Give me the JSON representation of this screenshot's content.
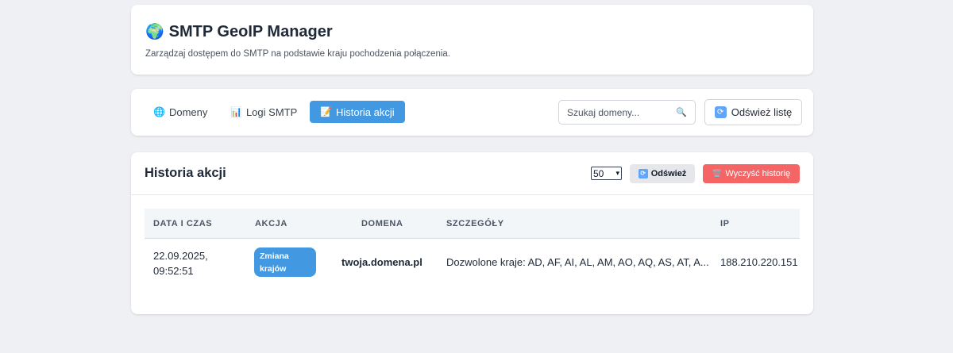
{
  "header": {
    "globe_icon": "🌍",
    "title": "SMTP GeoIP Manager",
    "subtitle": "Zarządzaj dostępem do SMTP na podstawie kraju pochodzenia połączenia."
  },
  "nav": {
    "tabs": [
      {
        "icon": "🌐",
        "icon_name": "globe-icon",
        "label": "Domeny",
        "active": false
      },
      {
        "icon": "📊",
        "icon_name": "bar-chart-icon",
        "label": "Logi SMTP",
        "active": false
      },
      {
        "icon": "📝",
        "icon_name": "memo-icon",
        "label": "Historia akcji",
        "active": true
      }
    ],
    "search": {
      "placeholder": "Szukaj domeny...",
      "value": "",
      "icon": "🔍"
    },
    "refresh_list": {
      "icon": "🔄",
      "label": "Odśwież listę"
    }
  },
  "history": {
    "title": "Historia akcji",
    "limit": {
      "selected": "50"
    },
    "refresh_button": {
      "icon": "🔄",
      "label": "Odśwież"
    },
    "clear_button": {
      "icon": "🗑️",
      "label": "Wyczyść historię"
    },
    "columns": [
      "DATA I CZAS",
      "AKCJA",
      "DOMENA",
      "SZCZEGÓŁY",
      "IP"
    ],
    "rows": [
      {
        "date": "22.09.2025,",
        "time": "09:52:51",
        "action": "Zmiana krajów",
        "domain": "twoja.domena.pl",
        "details": "Dozwolone kraje: AD, AF, AI, AL, AM, AO, AQ, AS, AT, A...",
        "ip": "188.210.220.151"
      }
    ]
  },
  "colors": {
    "accent": "#4299e1",
    "danger": "#f56565",
    "background": "#eef0f4"
  }
}
